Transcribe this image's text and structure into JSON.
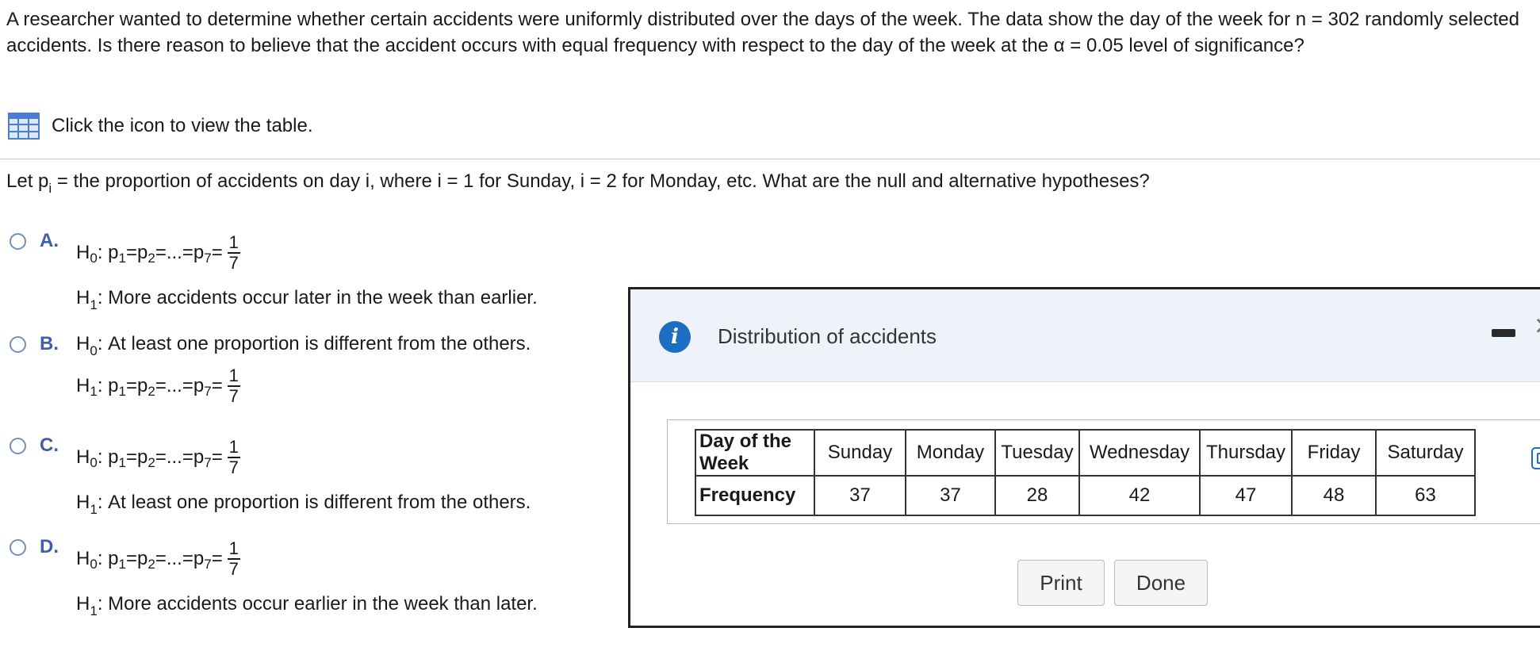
{
  "question": {
    "text": "A researcher wanted to determine whether certain accidents were uniformly distributed over the days of the week. The data show the day of the week for n = 302 randomly selected accidents. Is there reason to believe that the accident occurs with equal frequency with respect to the day of the week at the α = 0.05 level of significance?",
    "table_link": "Click the icon to view the table."
  },
  "let_line": {
    "before": "Let p",
    "sub": "i",
    "after": " = the proportion of accidents on day i, where i = 1 for Sunday, i = 2 for Monday, etc. What are the null and alternative hypotheses?"
  },
  "hyp": {
    "h": "H",
    "sub0": "0",
    "sub1": "1",
    "colon": ":",
    "p": "p",
    "ps1": "1",
    "ps2": "2",
    "ps7": "7",
    "eq": " = ",
    "dots": "...",
    "num": "1",
    "den": "7",
    "at_least_one": "At least one proportion is different from the others.",
    "later": "More accidents occur later in the week than earlier.",
    "earlier": "More accidents occur earlier in the week than later."
  },
  "options": [
    {
      "letter": "A."
    },
    {
      "letter": "B."
    },
    {
      "letter": "C."
    },
    {
      "letter": "D."
    }
  ],
  "dialog": {
    "title": "Distribution of accidents",
    "info_glyph": "i",
    "close_glyph": "×",
    "table": {
      "row_headers": [
        "Day of the Week",
        "Frequency"
      ],
      "days": [
        "Sunday",
        "Monday",
        "Tuesday",
        "Wednesday",
        "Thursday",
        "Friday",
        "Saturday"
      ],
      "frequencies": [
        "37",
        "37",
        "28",
        "42",
        "47",
        "48",
        "63"
      ]
    },
    "print_label": "Print",
    "done_label": "Done"
  }
}
